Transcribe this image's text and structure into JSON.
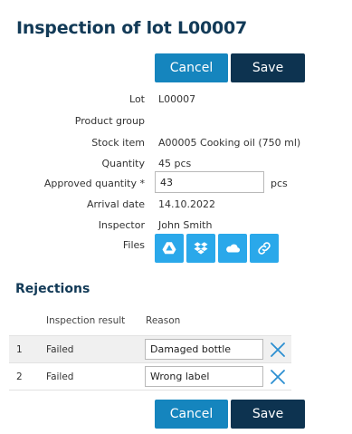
{
  "header": {
    "title": "Inspection of lot L00007"
  },
  "actions": {
    "cancel_label": "Cancel",
    "save_label": "Save"
  },
  "fields": {
    "lot": {
      "label": "Lot",
      "value": "L00007"
    },
    "product_group": {
      "label": "Product group",
      "value": ""
    },
    "stock_item": {
      "label": "Stock item",
      "value": "A00005 Cooking oil (750 ml)"
    },
    "quantity": {
      "label": "Quantity",
      "value": "45 pcs"
    },
    "approved_quantity": {
      "label": "Approved quantity *",
      "value": "43",
      "unit": "pcs"
    },
    "arrival_date": {
      "label": "Arrival date",
      "value": "14.10.2022"
    },
    "inspector": {
      "label": "Inspector",
      "value": "John Smith"
    },
    "files": {
      "label": "Files",
      "buttons": [
        "google-drive-icon",
        "dropbox-icon",
        "onedrive-icon",
        "link-icon"
      ]
    }
  },
  "rejections": {
    "title": "Rejections",
    "columns": [
      "Inspection result",
      "Reason"
    ],
    "rows": [
      {
        "index": "1",
        "result": "Failed",
        "reason": "Damaged bottle"
      },
      {
        "index": "2",
        "result": "Failed",
        "reason": "Wrong label"
      }
    ]
  },
  "colors": {
    "title": "#123a57",
    "cancel_button": "#1585be",
    "save_button": "#0d3350",
    "file_button": "#2aa8ea",
    "delete_icon": "#2c8fd1"
  }
}
